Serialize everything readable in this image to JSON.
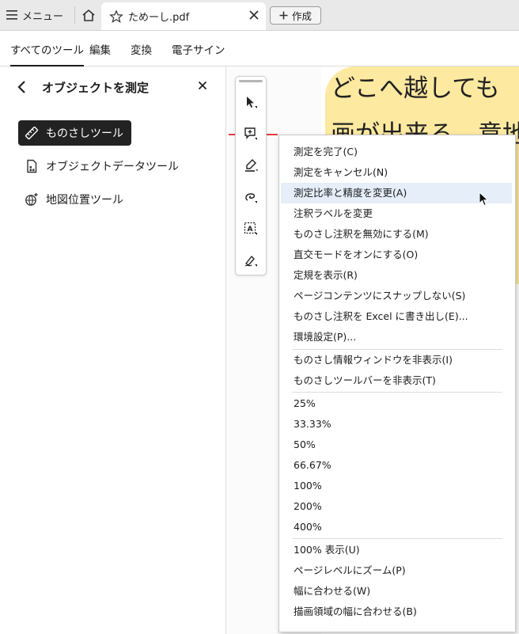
{
  "tabbar": {
    "menu_label": "メニュー",
    "doc_tab_name": "ためーし.pdf",
    "new_button_label": "作成"
  },
  "toolbar_tabs": [
    {
      "label": "すべてのツール",
      "active": true
    },
    {
      "label": "編集",
      "active": false
    },
    {
      "label": "変換",
      "active": false
    },
    {
      "label": "電子サイン",
      "active": false
    }
  ],
  "panel": {
    "title": "オブジェクトを測定",
    "tools": [
      {
        "label": "ものさしツール",
        "selected": true,
        "icon": "ruler-icon"
      },
      {
        "label": "オブジェクトデータツール",
        "selected": false,
        "icon": "object-data-icon"
      },
      {
        "label": "地図位置ツール",
        "selected": false,
        "icon": "globe-icon"
      }
    ]
  },
  "document": {
    "line1": "どこへ越しても",
    "line2": "画が出来る。意地"
  },
  "vertical_toolbar": [
    "select-icon",
    "add-comment-icon",
    "highlight-icon",
    "draw-icon",
    "text-box-icon",
    "sign-icon"
  ],
  "context_menu": {
    "group1": [
      "測定を完了(C)",
      "測定をキャンセル(N)",
      "測定比率と精度を変更(A)",
      "注釈ラベルを変更",
      "ものさし注釈を無効にする(M)",
      "直交モードをオンにする(O)",
      "定規を表示(R)",
      "ページコンテンツにスナップしない(S)",
      "ものさし注釈を Excel に書き出し(E)...",
      "環境設定(P)..."
    ],
    "group2": [
      "ものさし情報ウィンドウを非表示(I)",
      "ものさしツールバーを非表示(T)"
    ],
    "group3": [
      "25%",
      "33.33%",
      "50%",
      "66.67%",
      "100%",
      "200%",
      "400%"
    ],
    "group4": [
      "100% 表示(U)",
      "ページレベルにズーム(P)",
      "幅に合わせる(W)",
      "描画領域の幅に合わせる(B)"
    ],
    "hover_item": "測定比率と精度を変更(A)"
  },
  "colors": {
    "selected_tool_bg": "#222222",
    "highlight": "#fde9a0",
    "measure_line": "#e23a3a",
    "menu_hover": "#e5eef9"
  }
}
